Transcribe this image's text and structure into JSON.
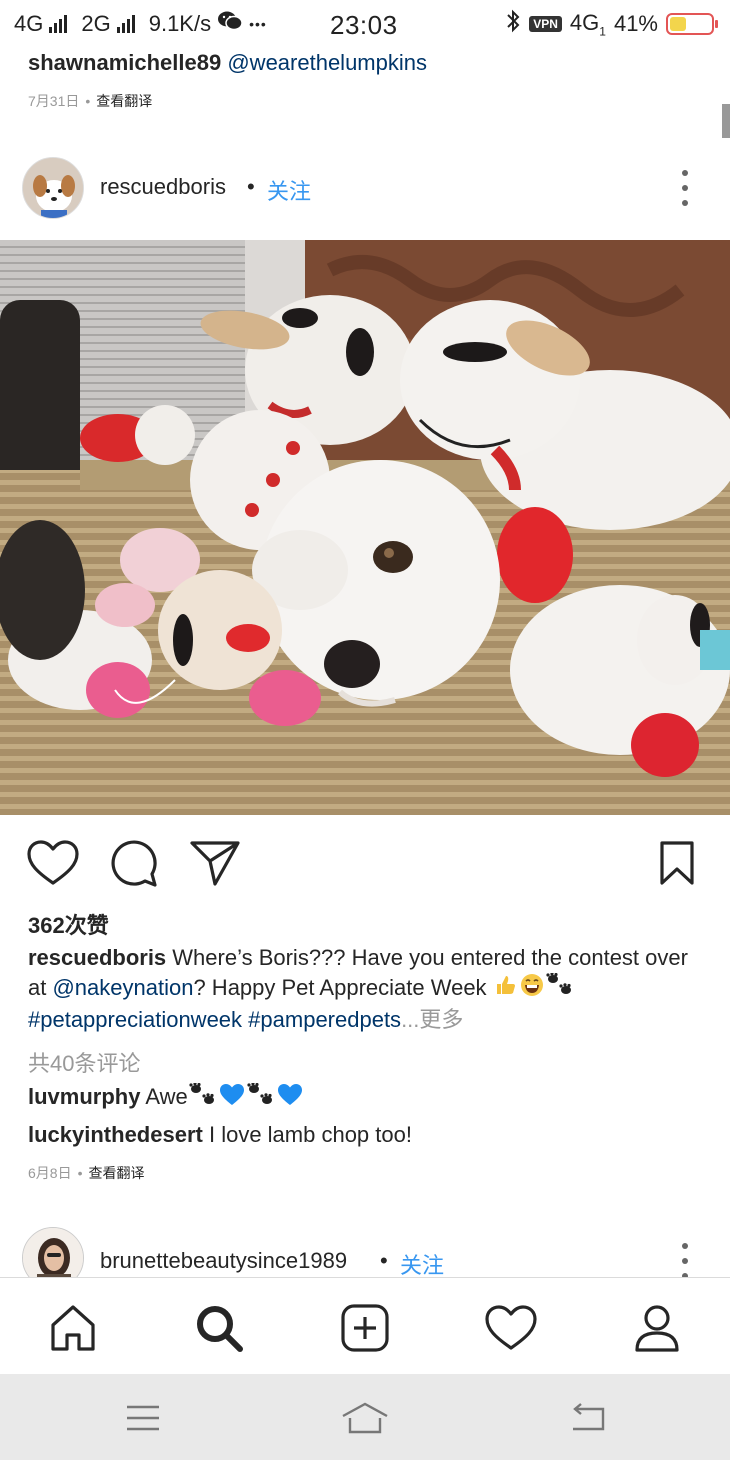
{
  "status_bar": {
    "net1": "4G",
    "net2": "2G",
    "speed": "9.1K/s",
    "more": "•••",
    "time": "23:03",
    "vpn": "VPN",
    "net3": "4G",
    "net3_sub": "1",
    "battery": "41%"
  },
  "prev_post": {
    "username": "shawnamichelle89",
    "mention": "@wearethelumpkins",
    "date": "7月31日",
    "translate": "查看翻译"
  },
  "post": {
    "username": "rescuedboris",
    "follow": "关注",
    "photo_icon": "photo-plush-lambs-dog",
    "likes": "362次赞",
    "caption": {
      "username": "rescuedboris",
      "text_1": "Where’s Boris??? Have you entered the contest over at ",
      "mention": "@nakeynation",
      "text_2": "? Happy Pet Appreciate Week ",
      "tag_1": "#petappreciationweek",
      "tag_2": "#pamperedpets",
      "ellipsis": "...",
      "more": "更多"
    },
    "view_comments": "共40条评论",
    "comments": [
      {
        "username": "luvmurphy",
        "text": "Awe"
      },
      {
        "username": "luckyinthedesert",
        "text": "I love lamb chop too!"
      }
    ],
    "date": "6月8日",
    "translate": "查看翻译"
  },
  "next_post": {
    "username": "brunettebeautysince1989",
    "follow": "关注"
  },
  "tab_bar": {
    "items": [
      "home-icon",
      "search-icon",
      "new-post-icon",
      "activity-icon",
      "profile-icon"
    ]
  },
  "colors": {
    "link_blue": "#3897f0",
    "mention_blue": "#003569",
    "muted_gray": "#999999"
  }
}
